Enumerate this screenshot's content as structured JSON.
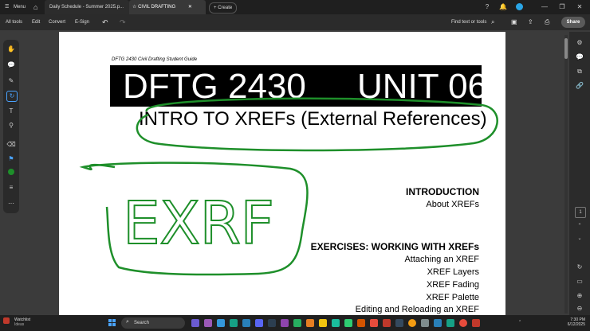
{
  "titlebar": {
    "menu_label": "Menu",
    "tabs": [
      {
        "label": "Daily Schedule - Summer 2025.p..."
      },
      {
        "label": "CIVIL DRAFTING"
      }
    ],
    "create_label": "Create"
  },
  "menubar": {
    "items": [
      "All tools",
      "Edit",
      "Convert",
      "E-Sign"
    ],
    "find_label": "Find text or tools",
    "share_label": "Share"
  },
  "document": {
    "guide_label": "DFTG 2430 Civil Drafting  Student Guide",
    "course_code": "DFTG 2430",
    "unit_label": "UNIT 06",
    "subtitle": "INTRO TO XREFs (External References)",
    "handwriting": "EXRF",
    "introduction_heading": "INTRODUCTION",
    "introduction_item": "About XREFs",
    "exercises_heading": "EXERCISES:  WORKING WITH XREFs",
    "exercise_items": [
      "Attaching an XREF",
      "XREF Layers",
      "XREF Fading",
      "XREF Palette",
      "Editing and Reloading an XREF"
    ]
  },
  "rightrail": {
    "page_number": "1"
  },
  "taskbar": {
    "weather_title": "Watchlist",
    "weather_sub": "Ideas",
    "search_label": "Search",
    "time": "7:30 PM",
    "date": "6/12/2025"
  },
  "colors": {
    "ink_green": "#1e8f2a",
    "banner_black": "#000000"
  }
}
